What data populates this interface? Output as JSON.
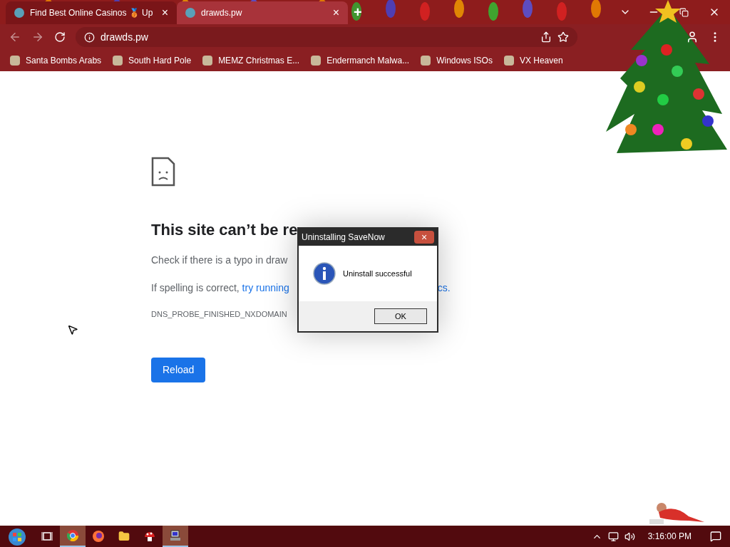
{
  "tabs": [
    {
      "title": "Find Best Online Casinos 🥉 Up",
      "selected": false,
      "close": "×"
    },
    {
      "title": "drawds.pw",
      "selected": true,
      "close": "×"
    }
  ],
  "new_tab": "+",
  "address_bar": {
    "url": "drawds.pw"
  },
  "bookmarks": [
    {
      "label": "Santa Bombs Arabs"
    },
    {
      "label": "South Hard Pole"
    },
    {
      "label": "MEMZ Christmas E..."
    },
    {
      "label": "Endermanch Malwa..."
    },
    {
      "label": "Windows ISOs"
    },
    {
      "label": "VX Heaven"
    }
  ],
  "error_page": {
    "heading": "This site can’t be re",
    "line_1": "Check if there is a typo in draw",
    "line_2_text": "If spelling is correct, ",
    "line_2_link": "try running",
    "line_2_tail": "cs.",
    "code": "DNS_PROBE_FINISHED_NXDOMAIN",
    "reload_button": "Reload"
  },
  "dialog": {
    "title": "Uninstalling SaveNow",
    "close": "×",
    "message": "Uninstall successful",
    "ok_button": "OK"
  },
  "taskbar": {
    "apps": [
      {
        "kind": "taskview",
        "selected": false
      },
      {
        "kind": "chrome",
        "selected": true
      },
      {
        "kind": "firefox",
        "selected": false
      },
      {
        "kind": "folder",
        "selected": false
      },
      {
        "kind": "mushroom",
        "selected": false
      },
      {
        "kind": "computer",
        "selected": true
      }
    ],
    "clock": "3:16:00 PM"
  }
}
